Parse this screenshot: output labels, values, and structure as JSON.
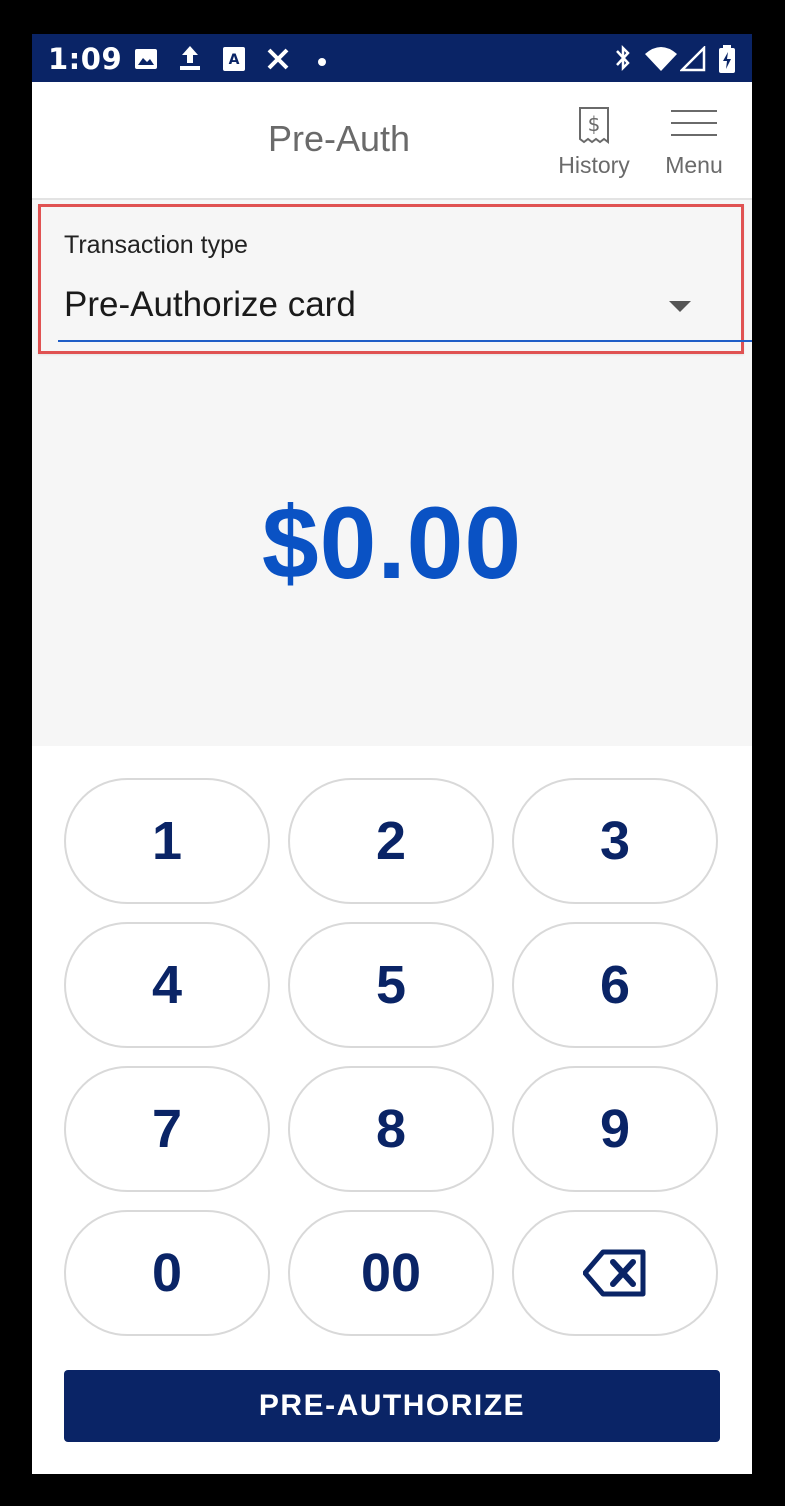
{
  "status_bar": {
    "time": "1:09",
    "left_icons": [
      "image-icon",
      "upload-icon",
      "font-app-icon",
      "fan-icon",
      "dot-icon"
    ],
    "right_icons": [
      "bluetooth-icon",
      "wifi-icon",
      "signal-icon",
      "battery-charging-icon"
    ]
  },
  "appbar": {
    "title": "Pre-Auth",
    "history_label": "History",
    "menu_label": "Menu"
  },
  "transaction": {
    "label": "Transaction type",
    "value": "Pre-Authorize card"
  },
  "amount": "$0.00",
  "keypad": {
    "keys": [
      "1",
      "2",
      "3",
      "4",
      "5",
      "6",
      "7",
      "8",
      "9",
      "0",
      "00"
    ],
    "backspace_icon": "backspace-icon"
  },
  "action_button": "PRE-AUTHORIZE",
  "colors": {
    "primary": "#0a2466",
    "amount": "#0a52c4",
    "highlight_border": "#e05252",
    "underline": "#1f5ec7"
  }
}
